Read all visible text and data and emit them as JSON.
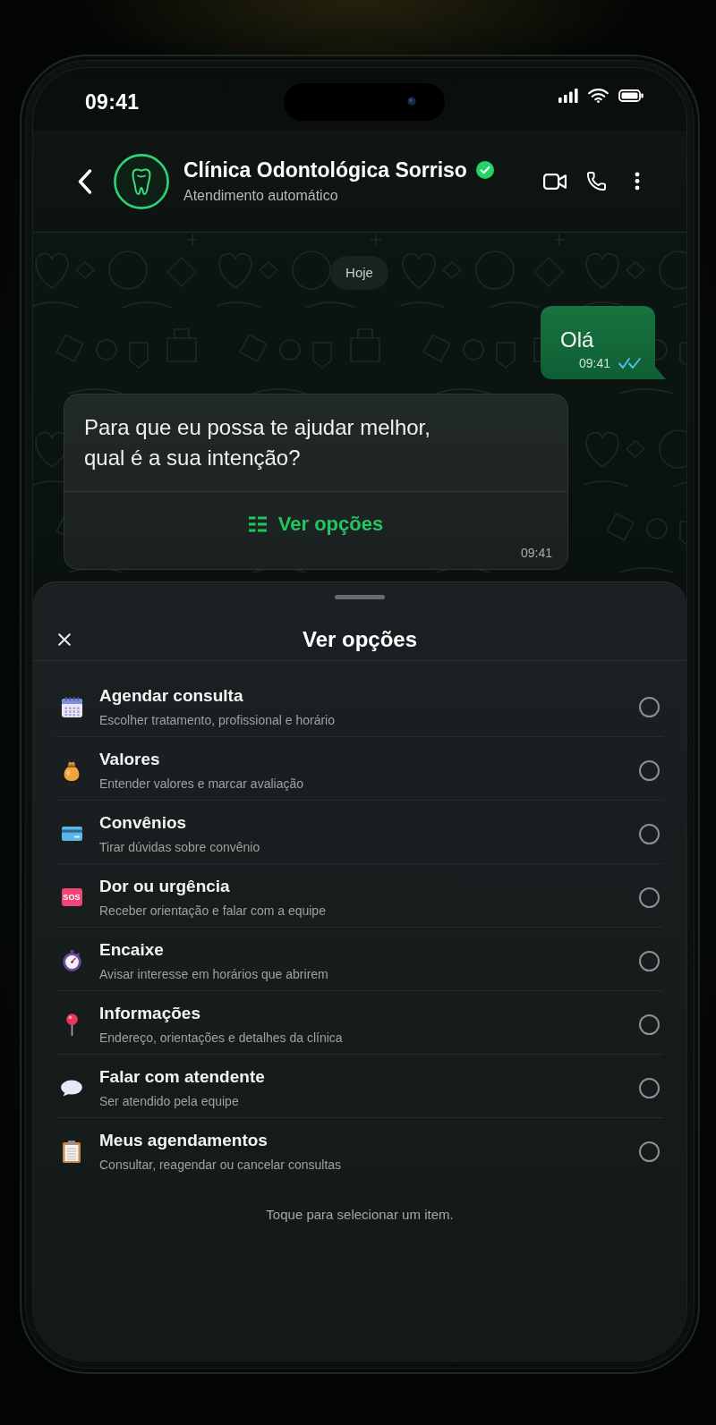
{
  "status_bar": {
    "time": "09:41"
  },
  "chat_header": {
    "title": "Clínica Odontológica Sorriso",
    "verified": true,
    "subtitle": "Atendimento automático"
  },
  "chat": {
    "date_chip": "Hoje",
    "messages": [
      {
        "kind": "outgoing",
        "text": "Olá",
        "time": "09:41",
        "read": true
      },
      {
        "kind": "incoming",
        "text": "Para que eu possa te ajudar melhor, qual é a sua intenção?",
        "button": "Ver opções",
        "time": "09:41"
      }
    ]
  },
  "sheet": {
    "title": "Ver opções",
    "items": [
      {
        "kind": "schedule",
        "title": "Agendar consulta",
        "description": "Escolher tratamento, profissional e horário",
        "selected": false
      },
      {
        "kind": "prices",
        "title": "Valores",
        "description": "Entender valores e marcar avaliação",
        "selected": false
      },
      {
        "kind": "insurance",
        "title": "Convênios",
        "description": "Tirar dúvidas sobre convênio",
        "selected": false
      },
      {
        "kind": "urgency",
        "tag": "SOS",
        "title": "Dor ou urgência",
        "description": "Receber orientação e falar com a equipe",
        "selected": false
      },
      {
        "kind": "waitlist",
        "title": "Encaixe",
        "description": "Avisar interesse em horários que abrirem",
        "selected": false
      },
      {
        "kind": "info",
        "title": "Informações",
        "description": "Endereço, orientações e detalhes da clínica",
        "selected": false
      },
      {
        "kind": "attendant",
        "title": "Falar com atendente",
        "description": "Ser atendido pela equipe",
        "selected": false
      },
      {
        "kind": "appointments",
        "title": "Meus agendamentos",
        "description": "Consultar, reagendar ou cancelar consultas",
        "selected": false
      }
    ],
    "footer": "Toque para selecionar um item."
  }
}
